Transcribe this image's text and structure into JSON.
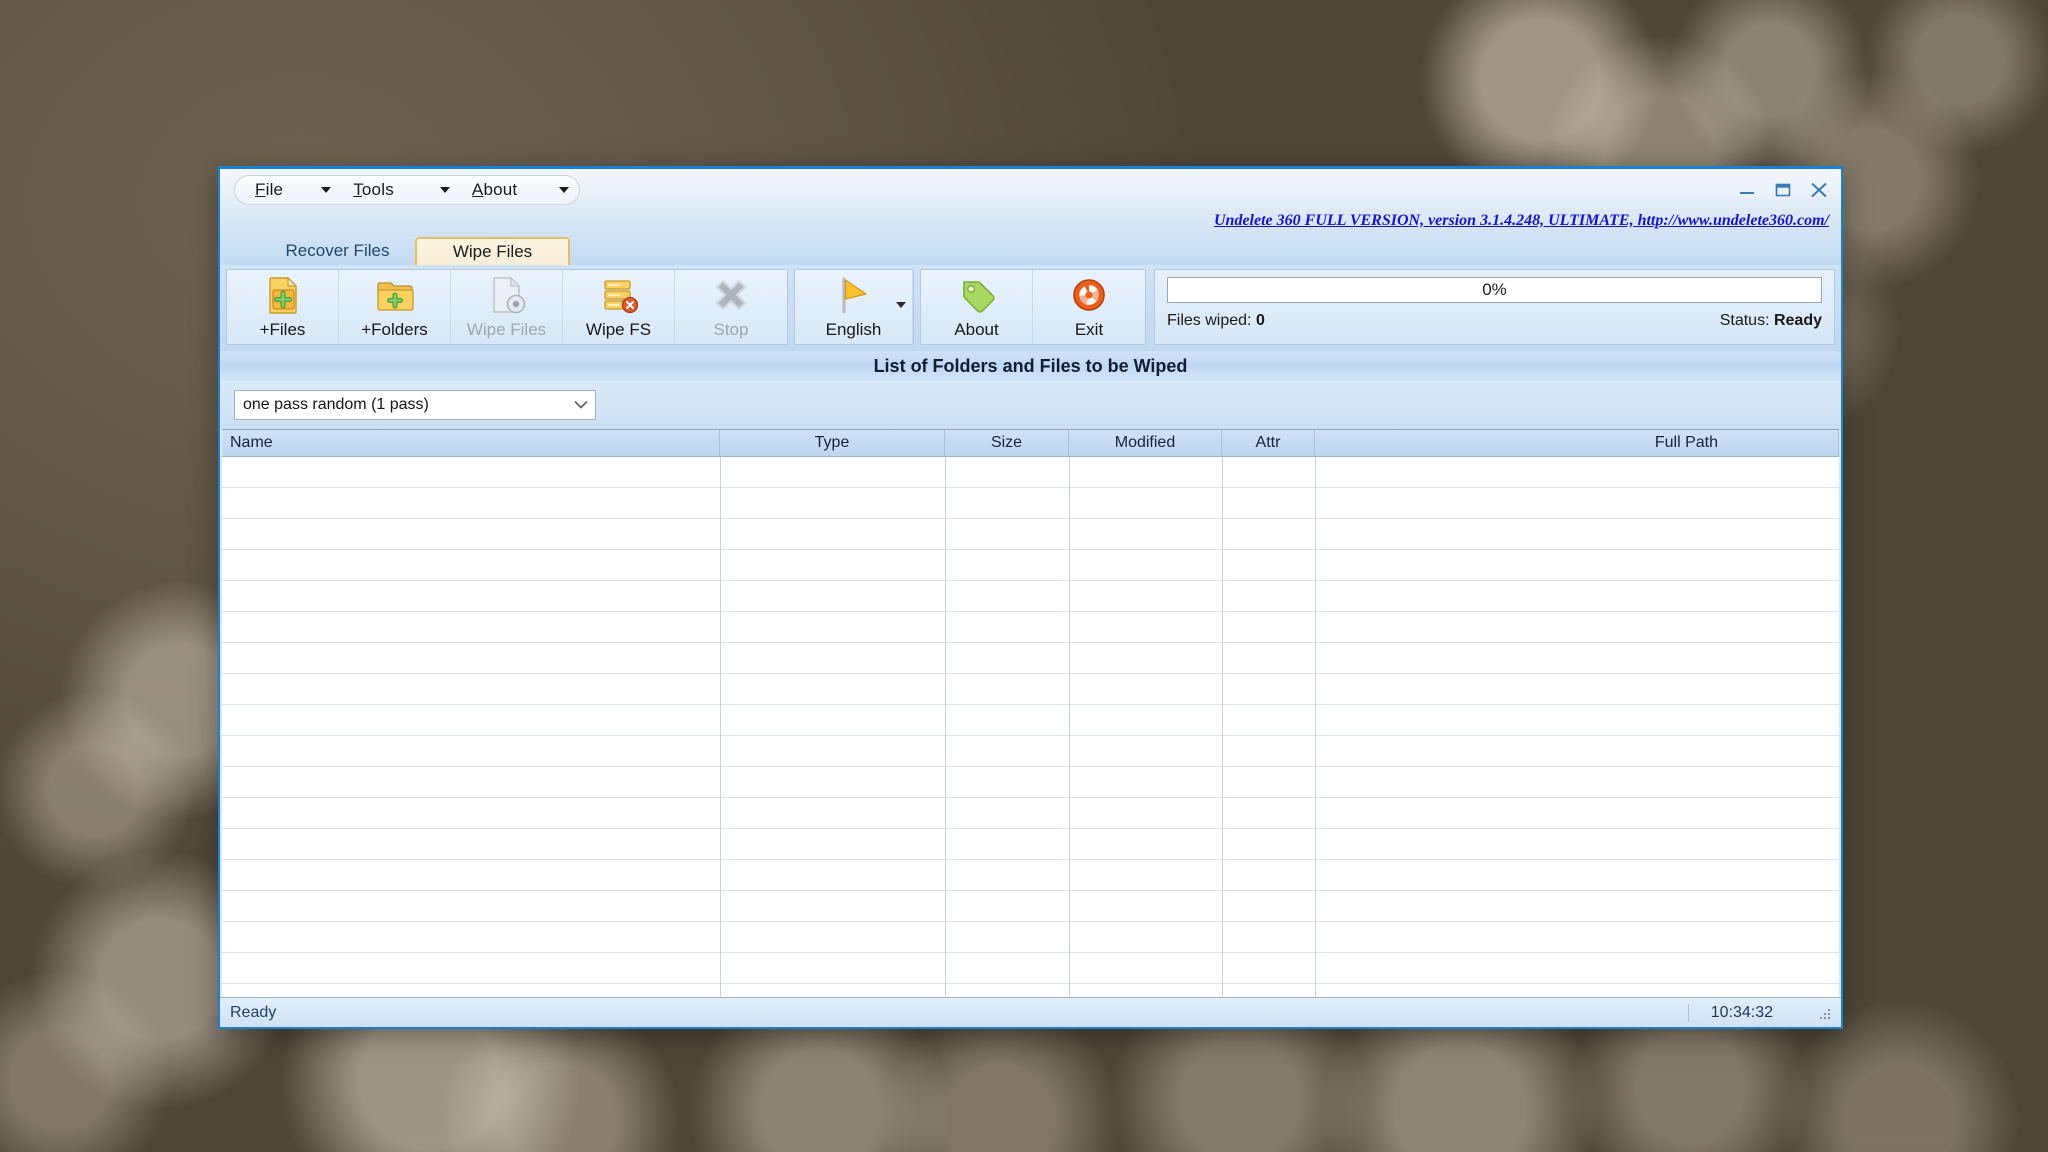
{
  "window": {
    "controls": {
      "minimize": "minimize-button",
      "maximize": "maximize-button",
      "close": "close-button"
    }
  },
  "menu": {
    "items": [
      {
        "label": "File",
        "accel": "F"
      },
      {
        "label": "Tools",
        "accel": "T"
      },
      {
        "label": "About",
        "accel": "A"
      }
    ]
  },
  "version_link": "Undelete 360 FULL VERSION, version 3.1.4.248, ULTIMATE, http://www.undelete360.com/",
  "tabs": [
    {
      "label": "Recover Files",
      "active": false
    },
    {
      "label": "Wipe Files",
      "active": true
    }
  ],
  "toolbar": {
    "buttons": [
      {
        "label": "+Files",
        "icon": "file-add-icon",
        "enabled": true
      },
      {
        "label": "+Folders",
        "icon": "folder-add-icon",
        "enabled": true
      },
      {
        "label": "Wipe Files",
        "icon": "file-wipe-icon",
        "enabled": false
      },
      {
        "label": "Wipe FS",
        "icon": "drive-wipe-icon",
        "enabled": true
      },
      {
        "label": "Stop",
        "icon": "stop-x-icon",
        "enabled": false
      }
    ],
    "language": {
      "label": "English",
      "icon": "flag-icon"
    },
    "about": {
      "label": "About",
      "icon": "tag-icon"
    },
    "exit": {
      "label": "Exit",
      "icon": "power-icon"
    }
  },
  "progress": {
    "percent_label": "0%",
    "percent_value": 0,
    "files_wiped_label": "Files wiped:",
    "files_wiped_value": "0",
    "status_label": "Status:",
    "status_value": "Ready"
  },
  "section_heading": "List of Folders and Files to be Wiped",
  "wipe_method": {
    "selected": "one pass random (1 pass)",
    "options": [
      "one pass random (1 pass)"
    ]
  },
  "table": {
    "columns": [
      {
        "label": "Name",
        "align": "left"
      },
      {
        "label": "Type",
        "align": "center"
      },
      {
        "label": "Size",
        "align": "center"
      },
      {
        "label": "Modified",
        "align": "center"
      },
      {
        "label": "Attr",
        "align": "center"
      },
      {
        "label": "Full Path",
        "align": "right"
      }
    ],
    "rows": []
  },
  "statusbar": {
    "message": "Ready",
    "clock": "10:34:32"
  },
  "colors": {
    "accent_blue": "#1b7fd4",
    "tab_active_border": "#e8bb65",
    "link_blue": "#1414d0",
    "panel_blue": "#d9e8f7"
  }
}
